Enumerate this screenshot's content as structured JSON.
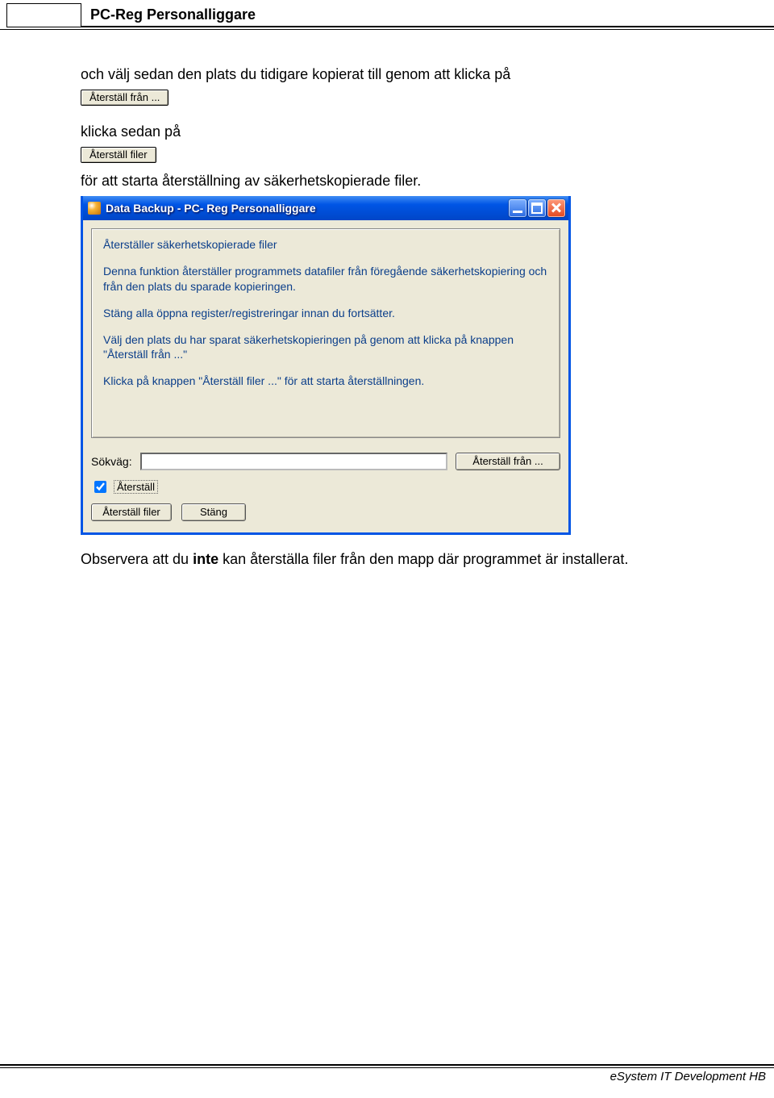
{
  "header": {
    "title": "PC-Reg Personalliggare"
  },
  "body": {
    "intro_line": "och välj sedan den plats du tidigare kopierat till genom att klicka på",
    "btn_restore_from": "Återställ från ...",
    "then_click": "klicka sedan på",
    "btn_restore_files": "Återställ filer",
    "to_start": "för att starta återställning av säkerhetskopierade filer."
  },
  "dialog": {
    "title": "Data Backup - PC- Reg Personalliggare",
    "info": {
      "title": "Återställer säkerhetskopierade filer",
      "p1": "Denna funktion återställer programmets datafiler från föregående säkerhetskopiering och från den plats du sparade kopieringen.",
      "p2": "Stäng alla öppna register/registreringar innan du fortsätter.",
      "p3": "Välj den plats du har sparat säkerhetskopieringen på genom att klicka på knappen \"Återställ från ...\"",
      "p4": "Klicka på knappen \"Återställ filer ...\" för att starta återställningen."
    },
    "path_label": "Sökväg:",
    "restore_from_btn": "Återställ från ...",
    "checkbox_label": "Återställ",
    "restore_files_btn": "Återställ filer",
    "close_btn": "Stäng"
  },
  "note": {
    "prefix": "Observera att du ",
    "bold": "inte",
    "suffix": " kan återställa filer från den mapp där programmet är installerat."
  },
  "footer": {
    "text": "eSystem IT Development HB"
  }
}
